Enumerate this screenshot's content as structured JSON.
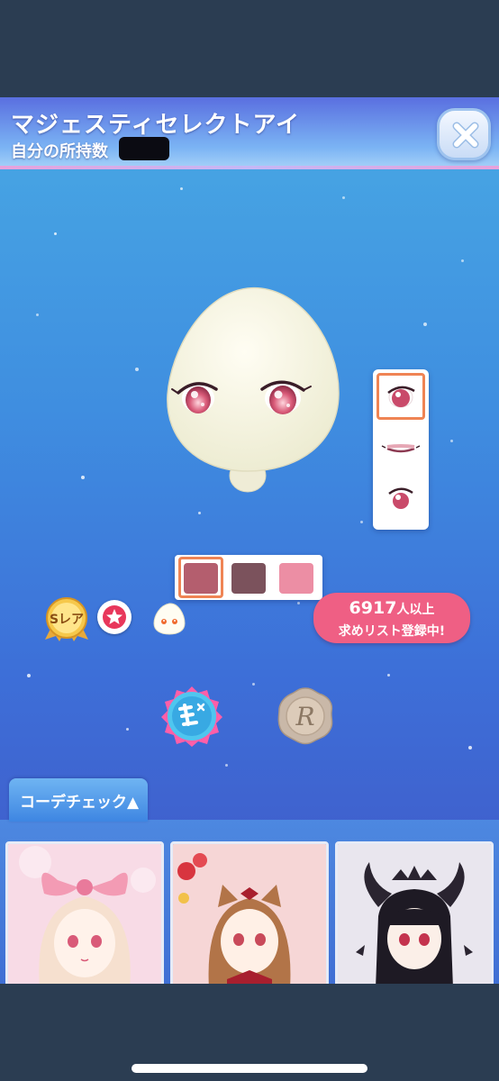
{
  "header": {
    "title": "マジェスティセレクトアイ",
    "owned_label": "自分の所持数"
  },
  "item": {
    "rarity_label": "Sレア"
  },
  "wish_list": {
    "count": "6917",
    "count_suffix": "人以上",
    "status": "求めリスト登録中!"
  },
  "colors": {
    "swatches": [
      "#b45e6e",
      "#7b525c",
      "#ec8ea4"
    ],
    "selected_index": 0,
    "accent": "#ef8454",
    "badge": "#ef5f84"
  },
  "coordinate_check": {
    "tab_label": "コーデチェック▲"
  },
  "icons": {
    "close": "close-icon",
    "favorite": "star-icon",
    "mascot": "mascot-icon",
    "edit": "edit-badge-icon",
    "reward": "seal-r-icon"
  }
}
